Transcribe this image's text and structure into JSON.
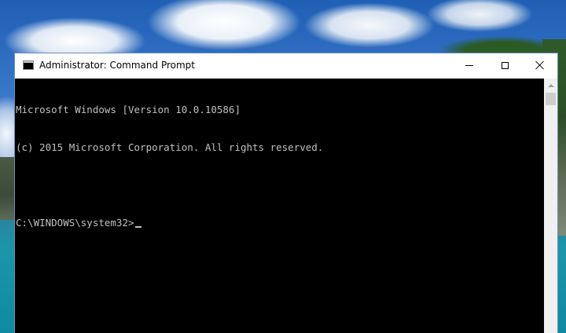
{
  "window": {
    "title": "Administrator: Command Prompt",
    "icon": "console-icon",
    "controls": {
      "minimize": "minimize-icon",
      "maximize": "maximize-icon",
      "close": "close-icon"
    }
  },
  "console": {
    "lines": [
      "Microsoft Windows [Version 10.0.10586]",
      "(c) 2015 Microsoft Corporation. All rights reserved.",
      "",
      "C:\\WINDOWS\\system32>"
    ],
    "text_color": "#c0c0c0",
    "background_color": "#000000"
  }
}
